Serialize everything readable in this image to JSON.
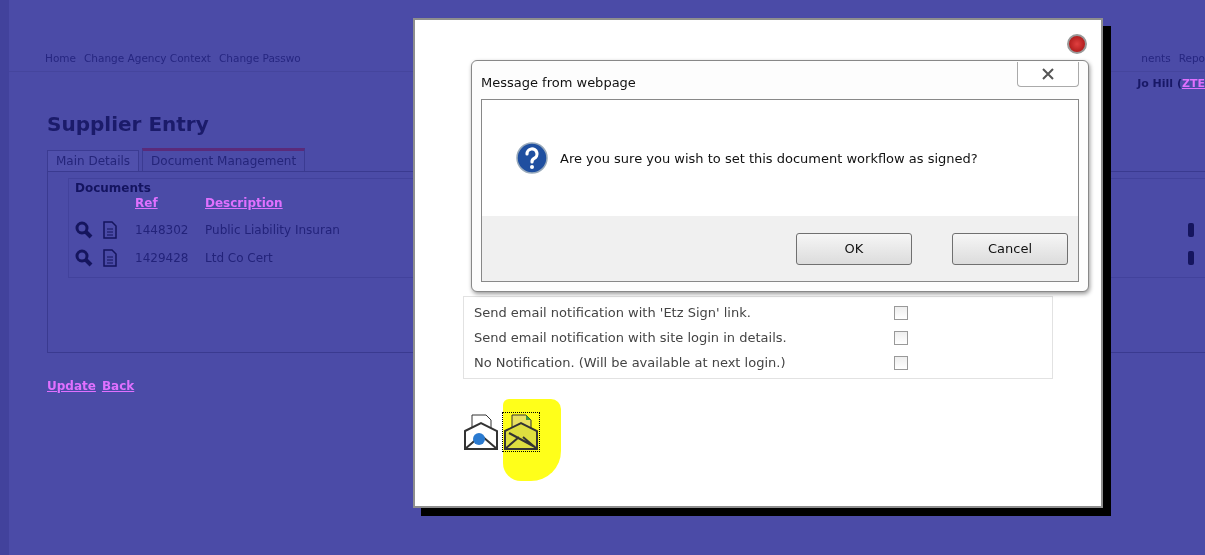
{
  "nav": {
    "left": [
      "Home",
      "Change Agency Context",
      "Change Passwo"
    ],
    "right": [
      "nents",
      "Repo"
    ]
  },
  "user": {
    "label": "Jo Hill (",
    "link": "ZTE"
  },
  "page": {
    "title": "Supplier Entry",
    "tabs": [
      {
        "label": "Main Details",
        "selected": false
      },
      {
        "label": "Document Management",
        "selected": true
      }
    ],
    "documents": {
      "title": "Documents",
      "columns": [
        "Ref",
        "Description"
      ],
      "rows": [
        {
          "ref": "1448302",
          "description": "Public Liability Insuran"
        },
        {
          "ref": "1429428",
          "description": "Ltd Co Cert"
        }
      ]
    },
    "links": [
      "Update",
      "Back"
    ]
  },
  "modal": {
    "options": [
      {
        "label": "Send email notification with 'Etz Sign' link.",
        "checked": false
      },
      {
        "label": "Send email notification with site login in details.",
        "checked": false
      },
      {
        "label": "No Notification. (Will be available at next login.)",
        "checked": false
      }
    ]
  },
  "alert": {
    "title": "Message from webpage",
    "message": "Are you sure you wish to set this document workflow as signed?",
    "buttons": [
      "OK",
      "Cancel"
    ]
  }
}
